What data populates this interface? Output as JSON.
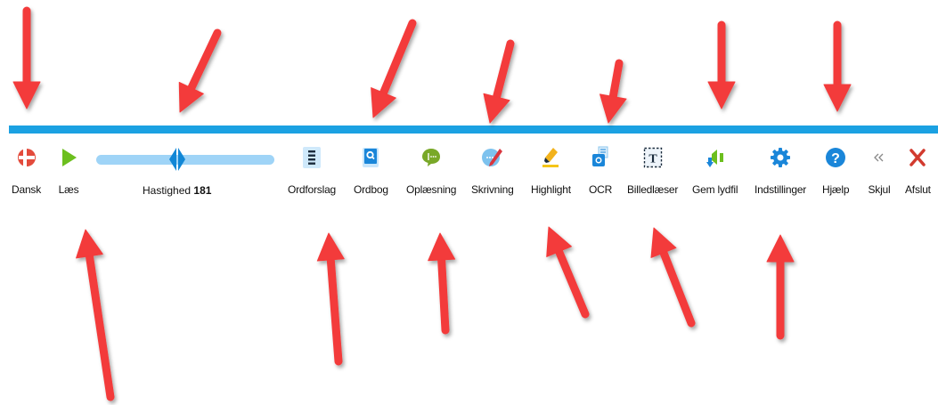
{
  "toolbar": {
    "language": {
      "label": "Dansk",
      "icon": "danish-flag-icon"
    },
    "read": {
      "label": "Læs",
      "icon": "play-icon"
    },
    "speed": {
      "label": "Hastighed",
      "value": "181"
    },
    "word_prediction": {
      "label": "Ordforslag",
      "icon": "word-prediction-icon"
    },
    "dictionary": {
      "label": "Ordbog",
      "icon": "dictionary-icon"
    },
    "reading_aloud": {
      "label": "Oplæsning",
      "icon": "speech-bubble-icon"
    },
    "writing": {
      "label": "Skrivning",
      "icon": "writing-pen-icon"
    },
    "highlight": {
      "label": "Highlight",
      "icon": "highlighter-icon"
    },
    "ocr": {
      "label": "OCR",
      "icon": "ocr-camera-icon"
    },
    "image_reader": {
      "label": "Billedlæser",
      "icon": "image-reader-icon"
    },
    "save_audio": {
      "label": "Gem lydfil",
      "icon": "save-audio-icon"
    },
    "settings": {
      "label": "Indstillinger",
      "icon": "gear-icon"
    },
    "help": {
      "label": "Hjælp",
      "icon": "help-icon"
    },
    "hide": {
      "label": "Skjul",
      "icon": "double-chevron-left-icon"
    },
    "close": {
      "label": "Afslut",
      "icon": "close-icon"
    }
  },
  "colors": {
    "accent": "#1ba1e2",
    "arrow": "#f33a3a",
    "slider_track": "#9fd4f7",
    "play": "#6cbf1e",
    "close": "#d23a2e"
  }
}
